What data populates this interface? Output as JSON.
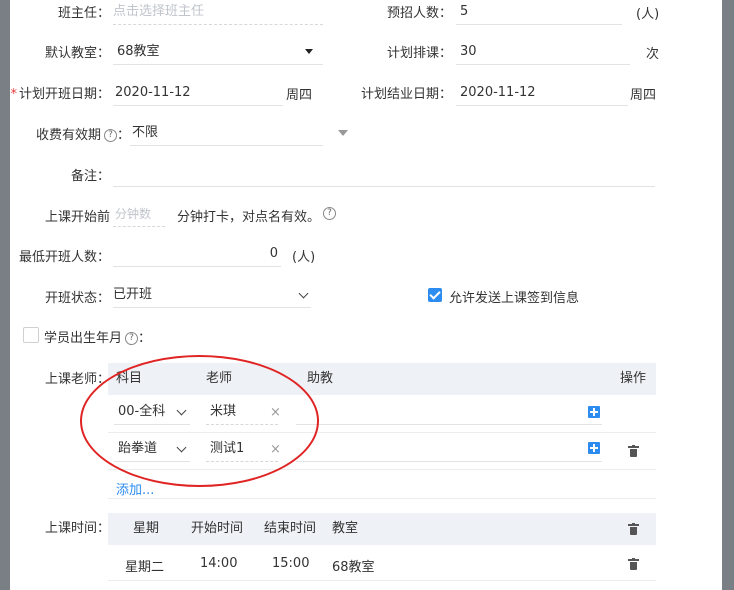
{
  "form": {
    "head_teacher": {
      "label": "班主任：",
      "placeholder": "点击选择班主任"
    },
    "expected_count": {
      "label": "预招人数：",
      "value": "5",
      "unit": "(人)"
    },
    "default_room": {
      "label": "默认教室：",
      "value": "68教室"
    },
    "planned_lessons": {
      "label": "计划排课：",
      "value": "30",
      "unit": "次"
    },
    "start_date": {
      "required": "*",
      "label": "计划开班日期：",
      "value": "2020-11-12",
      "weekday": "周四"
    },
    "end_date": {
      "label": "计划结业日期：",
      "value": "2020-11-12",
      "weekday": "周四"
    },
    "fee_validity": {
      "label": "收费有效期",
      "help": "?",
      "colon": "：",
      "value": "不限"
    },
    "remark": {
      "label": "备注："
    },
    "checkin": {
      "label": "上课开始前",
      "placeholder": "分钟数",
      "suffix": "分钟打卡，对点名有效。",
      "help": "?"
    },
    "min_students": {
      "label": "最低开班人数：",
      "value": "0",
      "unit": "(人)"
    },
    "class_status": {
      "label": "开班状态：",
      "value": "已开班"
    },
    "send_signin": {
      "label": "允许发送上课签到信息",
      "checked": true
    },
    "birth_month": {
      "label": "学员出生年月",
      "help": "?",
      "colon": "：",
      "checked": false
    }
  },
  "teachers": {
    "label": "上课老师：",
    "headers": {
      "subject": "科目",
      "teacher": "老师",
      "assistant": "助教",
      "action": "操作"
    },
    "rows": [
      {
        "subject": "00-全科",
        "teacher": "米琪",
        "remove": "×"
      },
      {
        "subject": "跆拳道",
        "teacher": "测试1",
        "remove": "×"
      }
    ],
    "add_link": "添加..."
  },
  "schedule": {
    "label": "上课时间：",
    "headers": {
      "weekday": "星期",
      "start": "开始时间",
      "end": "结束时间",
      "room": "教室"
    },
    "rows": [
      {
        "weekday": "星期二",
        "start": "14:00",
        "end": "15:00",
        "room": "68教室"
      }
    ]
  },
  "colors": {
    "accent": "#2d8cf0",
    "annotation": "#e02424",
    "required": "#e4393c"
  }
}
